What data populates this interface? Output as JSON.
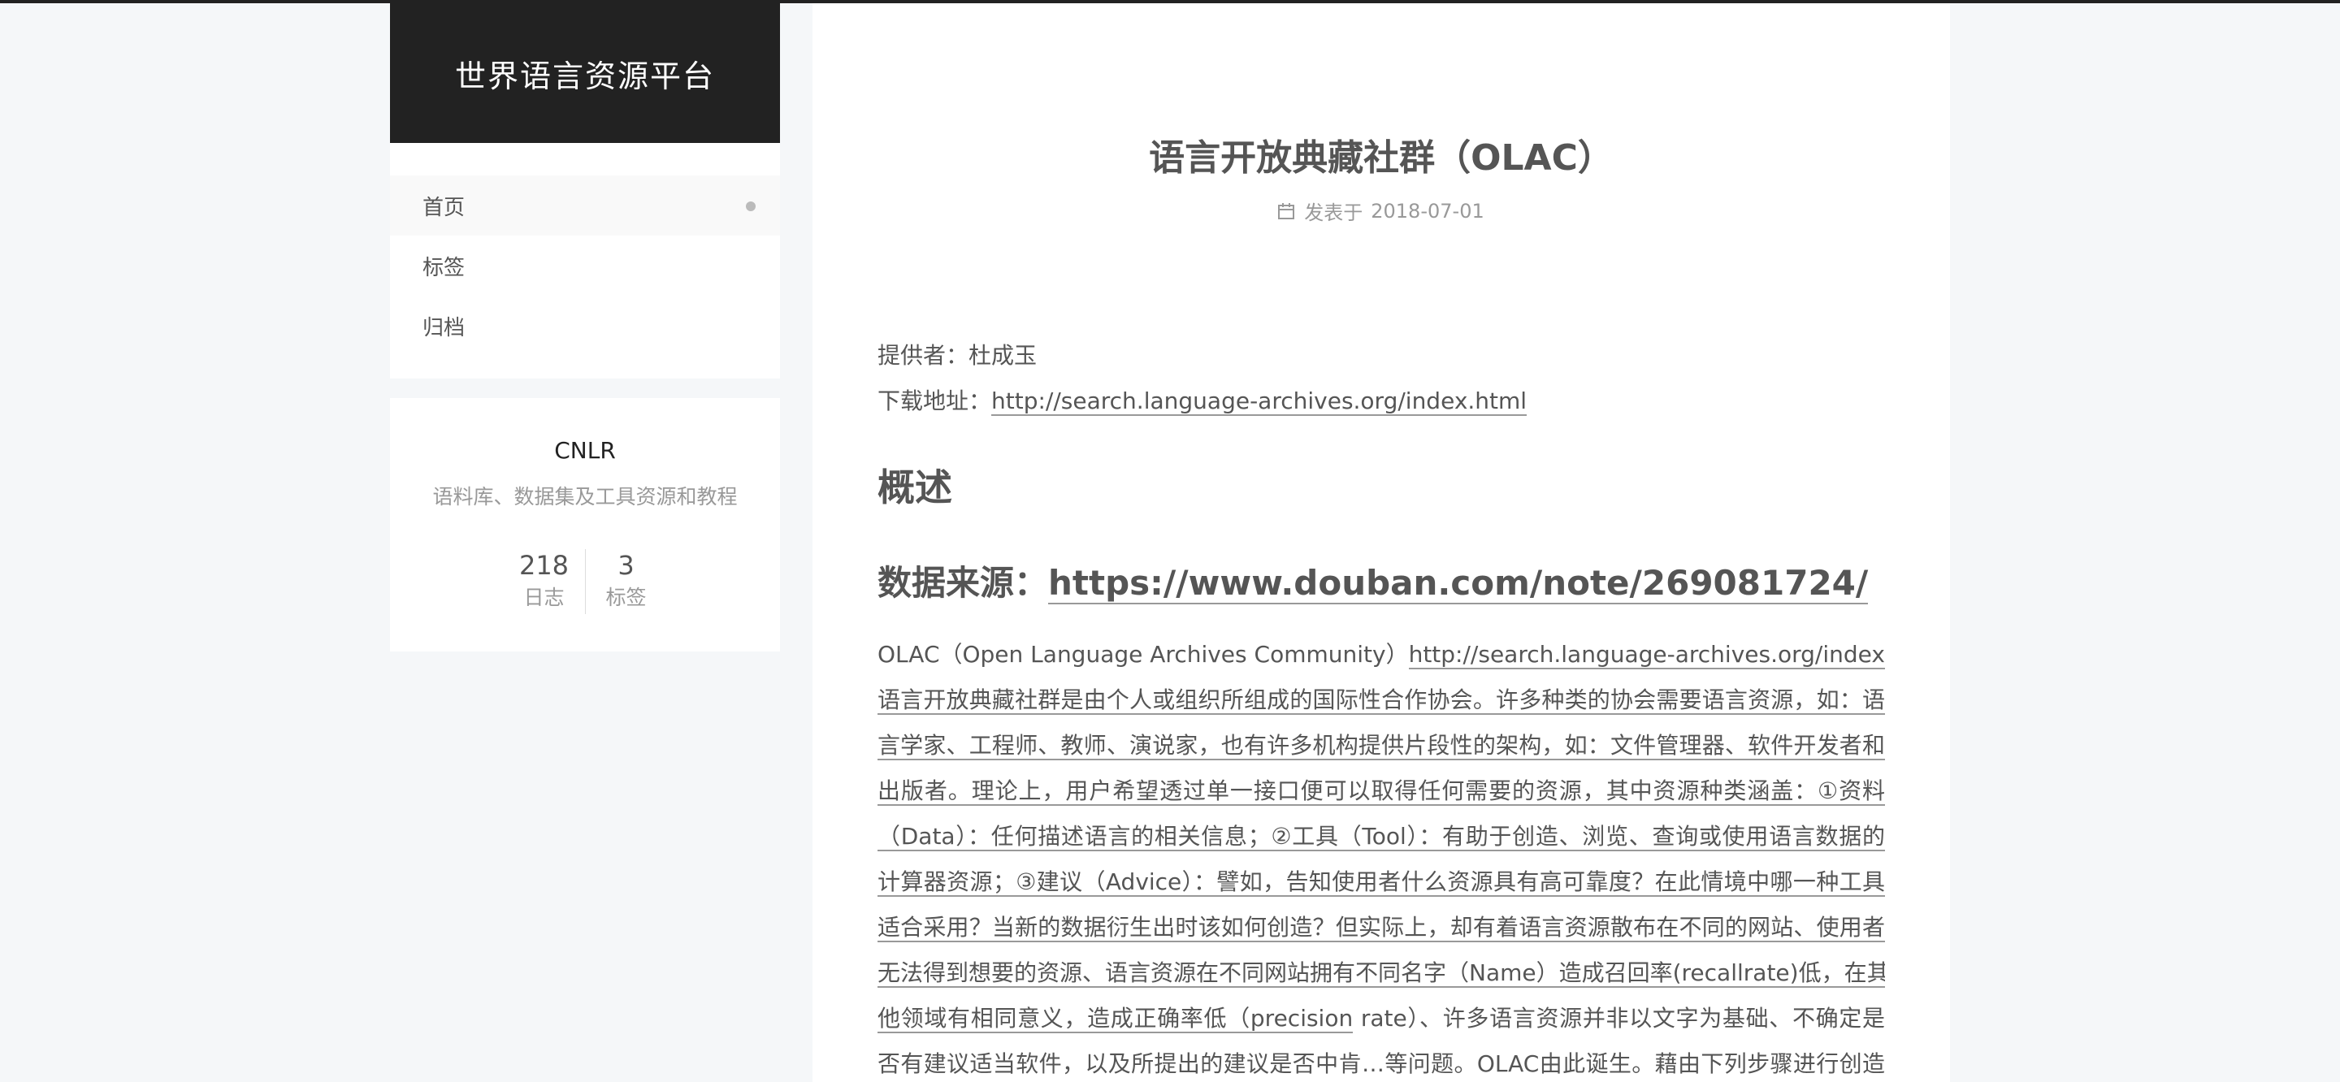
{
  "site": {
    "title": "世界语言资源平台"
  },
  "menu": {
    "items": [
      {
        "label": "首页"
      },
      {
        "label": "标签"
      },
      {
        "label": "归档"
      }
    ]
  },
  "overview": {
    "author": "CNLR",
    "description": "语料库、数据集及工具资源和教程",
    "stats": [
      {
        "count": "218",
        "label": "日志"
      },
      {
        "count": "3",
        "label": "标签"
      }
    ]
  },
  "post": {
    "title": "语言开放典藏社群（OLAC）",
    "meta": {
      "prefix": "发表于",
      "date": "2018-07-01"
    },
    "provider_label": "提供者：",
    "provider": "杜成玉",
    "download_label": "下载地址：",
    "download_url": "http://search.language-archives.org/index.html",
    "heading_overview": "概述",
    "source_label": "数据来源：",
    "source_url": "https://www.douban.com/note/269081724/",
    "paragraph": {
      "lead": "OLAC（Open Language Archives Community）",
      "lead_link": "http://search.language-archives.org/index.html",
      "lines": [
        "语言开放典藏社群是由个人或组织所组成的国际性合作协会。许多种类的协会需要语言资源，如：语",
        "言学家、工程师、教师、演说家，也有许多机构提供片段性的架构，如：文件管理器、软件开发者和",
        "出版者。理论上，用户希望透过单一接口便可以取得任何需要的资源，其中资源种类涵盖：①资料",
        "（Data）：任何描述语言的相关信息；②工具（Tool）：有助于创造、浏览、查询或使用语言数据的",
        "计算器资源；③建议（Advice）：譬如，告知使用者什么资源具有高可靠度？在此情境中哪一种工具",
        "适合采用？当新的数据衍生出时该如何创造？但实际上，却有着语言资源散布在不同的网站、使用者",
        "无法得到想要的资源、语言资源在不同网站拥有不同名字（Name）造成召回率(recallrate)低，在其",
        "他领域有相同意义，造成正确率低（precision",
        "rate）、许多语言资源并非以文字为基础、不确定是",
        "否有建议适当软件，以及所提出的建议是否中肯…等问题。OLAC由此诞生。藉由下列步骤进行创造"
      ]
    }
  }
}
